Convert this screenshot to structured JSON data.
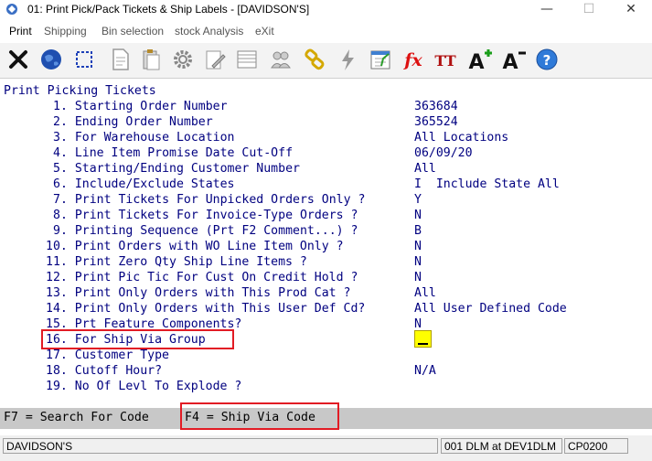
{
  "window": {
    "title": "01: Print Pick/Pack Tickets & Ship Labels - [DAVIDSON'S]",
    "controls": {
      "minimize": "—",
      "maximize": "☐",
      "close": "✕"
    }
  },
  "menu": {
    "items": [
      "Print",
      "Shipping",
      "Bin selection",
      "stock Analysis",
      "eXit"
    ]
  },
  "toolbar": {
    "icons": [
      "close-icon",
      "globe-icon",
      "select-icon",
      "document-icon",
      "clipboard-icon",
      "settings-gear-icon",
      "edit-icon",
      "list-icon",
      "users-icon",
      "link-icon",
      "lightning-icon",
      "calendar-icon",
      "function-icon",
      "font-size-icon",
      "increase-font-icon",
      "decrease-font-icon",
      "help-icon"
    ],
    "fx_text": "fx",
    "tt_text": "TT",
    "a_plus": "A",
    "a_minus": "A",
    "help_text": "?"
  },
  "screen": {
    "heading": "Print Picking Tickets",
    "options": [
      {
        "label": "1. Starting Order Number",
        "value": "363684"
      },
      {
        "label": "2. Ending Order Number",
        "value": "365524"
      },
      {
        "label": "3. For Warehouse Location",
        "value": "All Locations"
      },
      {
        "label": "4. Line Item Promise Date Cut-Off",
        "value": "06/09/20"
      },
      {
        "label": "5. Starting/Ending Customer Number",
        "value": "All"
      },
      {
        "label": "6. Include/Exclude States",
        "value": "I  Include State All"
      },
      {
        "label": "7. Print Tickets For Unpicked Orders Only ?",
        "value": "Y"
      },
      {
        "label": "8. Print Tickets For Invoice-Type Orders ?",
        "value": "N"
      },
      {
        "label": "9. Printing Sequence (Prt F2 Comment...) ?",
        "value": "B"
      },
      {
        "label": "10. Print Orders with WO Line Item Only ?",
        "value": "N"
      },
      {
        "label": "11. Print Zero Qty Ship Line Items ?",
        "value": "N"
      },
      {
        "label": "12. Print Pic Tic For Cust On Credit Hold ?",
        "value": "N"
      },
      {
        "label": "13. Print Only Orders with This Prod Cat ?",
        "value": "All"
      },
      {
        "label": "14. Print Only Orders with This User Def Cd?",
        "value": "All User Defined Code"
      },
      {
        "label": "15. Prt Feature Components?",
        "value": "N"
      },
      {
        "label": "16. For Ship Via Group",
        "value": ""
      },
      {
        "label": "17. Customer Type",
        "value": ""
      },
      {
        "label": "18. Cutoff Hour?",
        "value": "N/A"
      },
      {
        "label": "19. No Of Levl To Explode ?",
        "value": ""
      }
    ]
  },
  "function_keys": {
    "f7": "F7 = Search For Code",
    "f4": "F4 = Ship Via Code"
  },
  "status": {
    "company": "DAVIDSON'S",
    "session": "001 DLM at DEV1DLM",
    "program": "CP0200"
  },
  "colors": {
    "screen_text": "#000080",
    "highlight_box": "#e21b24",
    "input_cursor": "#ffff00",
    "fkey_bar": "#c8c8c8"
  }
}
